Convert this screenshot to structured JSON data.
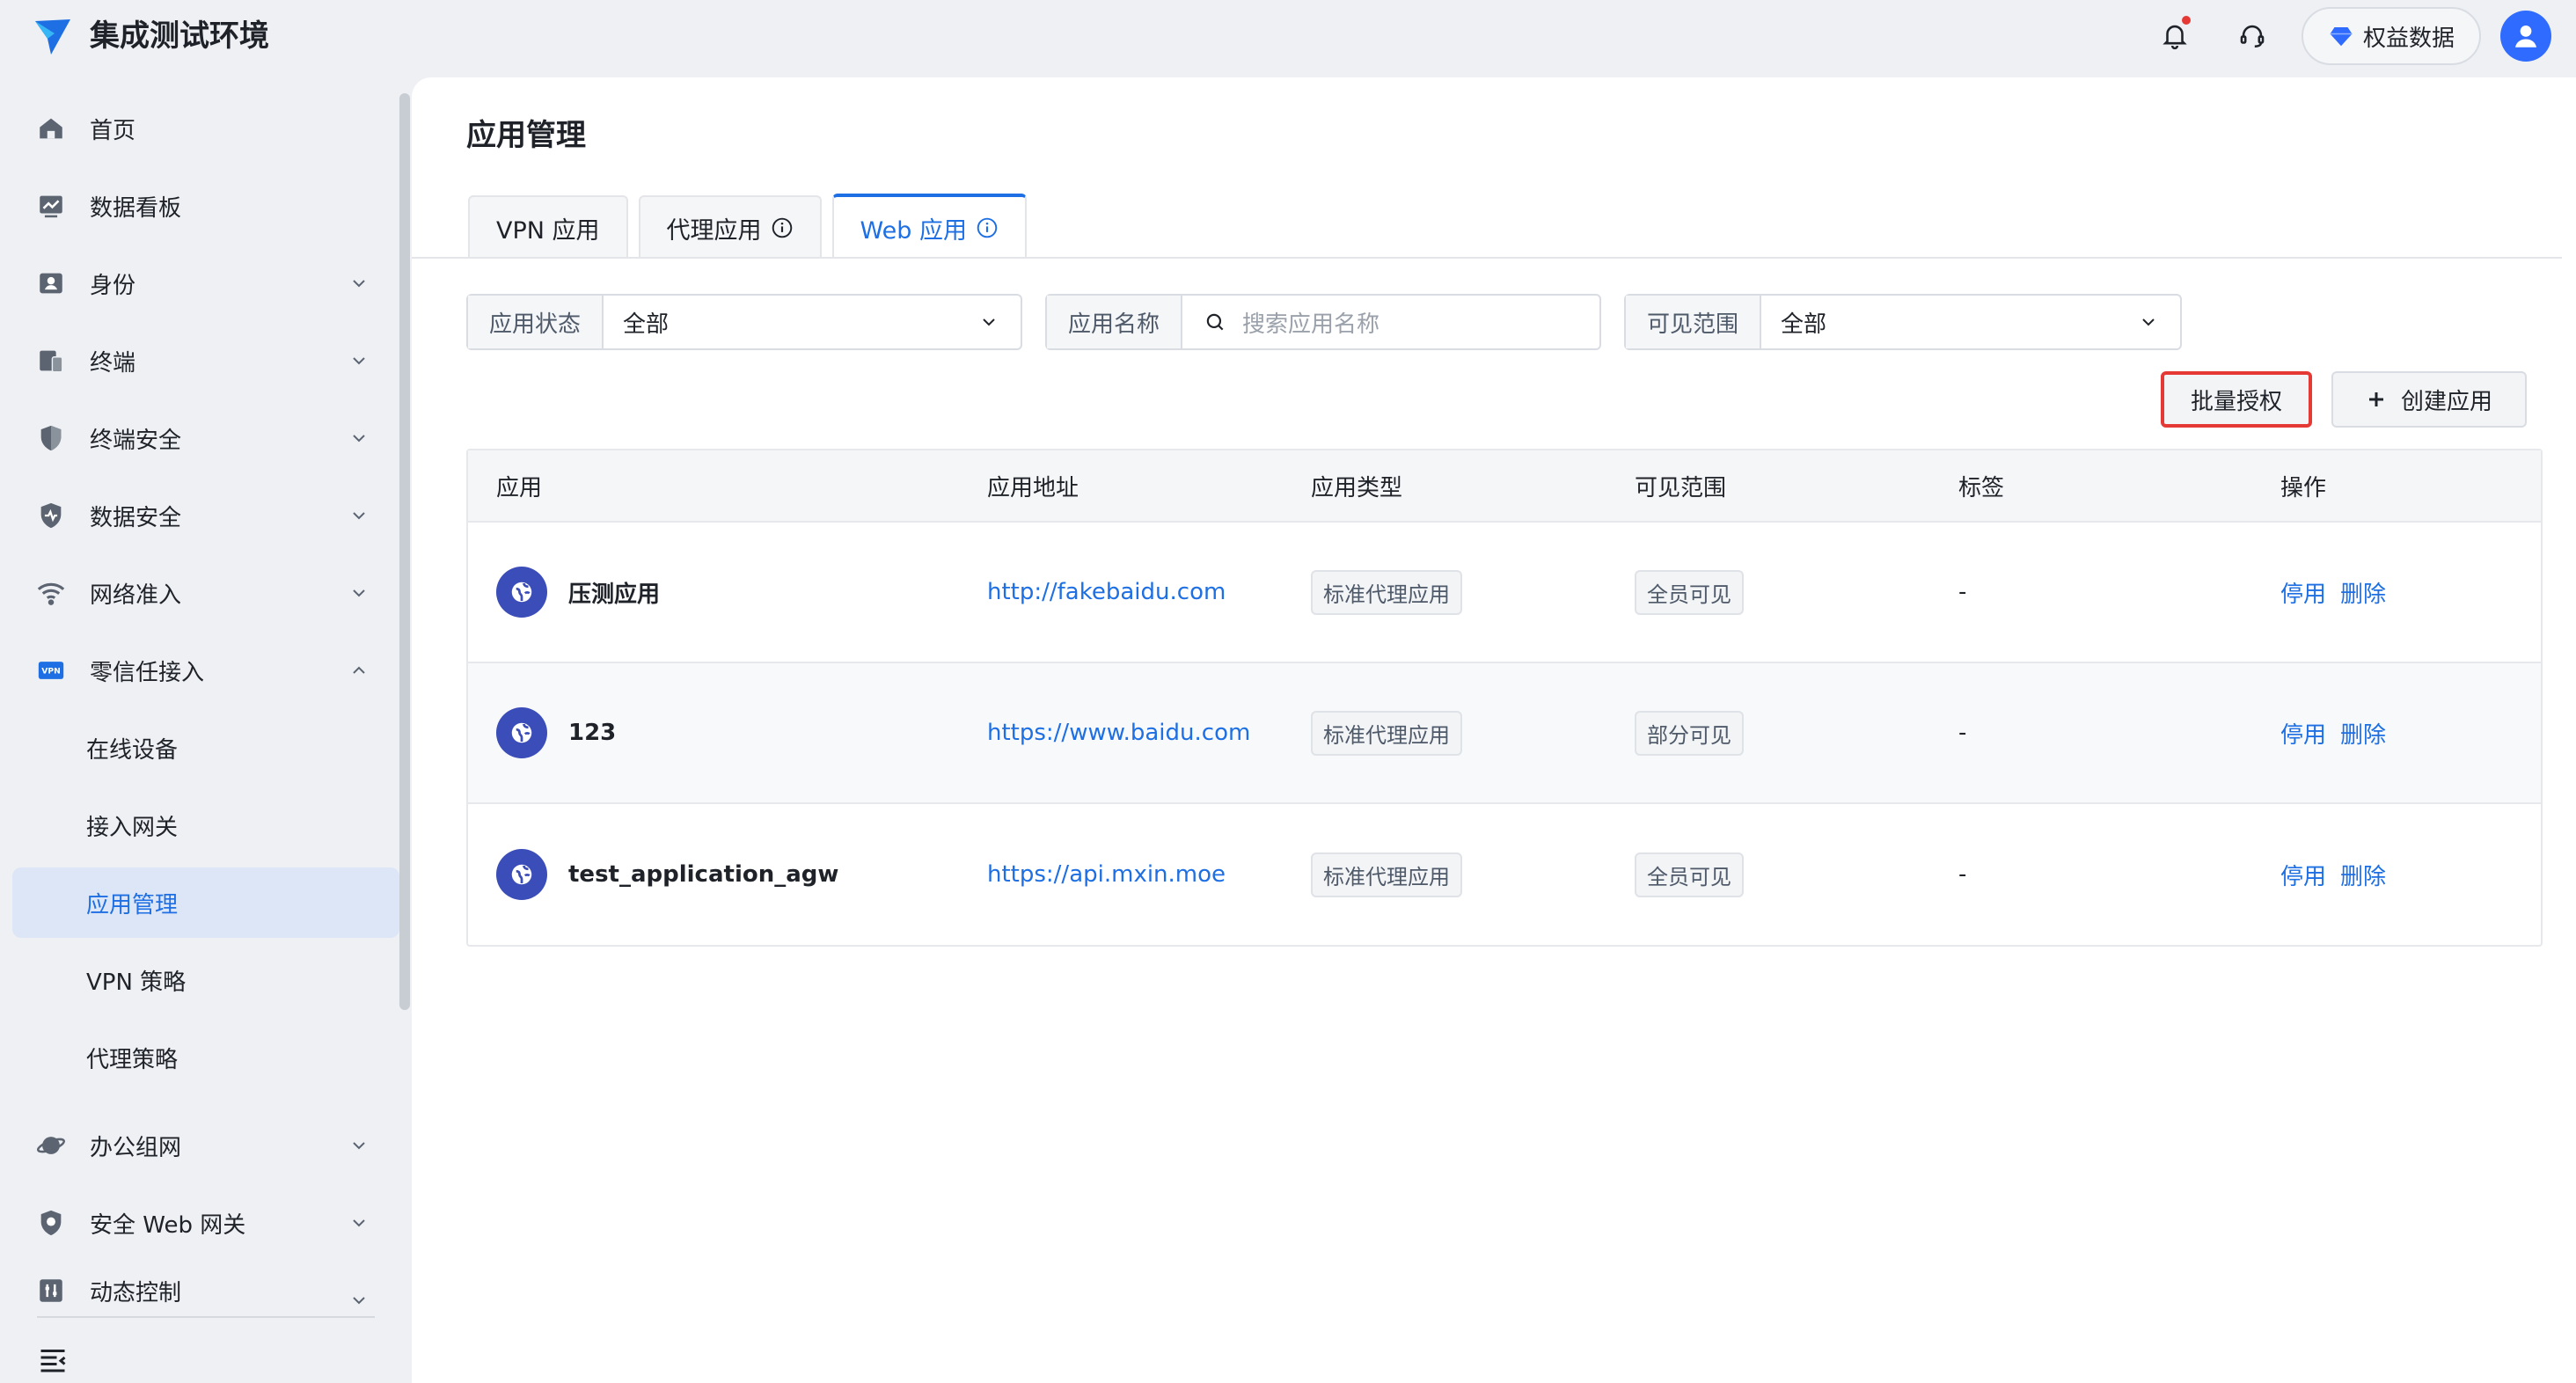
{
  "app": {
    "title": "集成测试环境"
  },
  "header": {
    "equity_label": "权益数据"
  },
  "sidebar": {
    "items": [
      {
        "label": "首页",
        "icon": "home-icon"
      },
      {
        "label": "数据看板",
        "icon": "dashboard-icon"
      },
      {
        "label": "身份",
        "icon": "identity-icon"
      },
      {
        "label": "终端",
        "icon": "devices-icon"
      },
      {
        "label": "终端安全",
        "icon": "shield-icon"
      },
      {
        "label": "数据安全",
        "icon": "data-shield-icon"
      },
      {
        "label": "网络准入",
        "icon": "wifi-icon"
      },
      {
        "label": "零信任接入",
        "icon": "vpn-icon"
      },
      {
        "label": "办公组网",
        "icon": "planet-icon"
      },
      {
        "label": "安全 Web 网关",
        "icon": "gateway-shield-icon"
      },
      {
        "label": "动态控制",
        "icon": "control-icon"
      }
    ],
    "sub_items": [
      "在线设备",
      "接入网关",
      "应用管理",
      "VPN 策略",
      "代理策略"
    ]
  },
  "main": {
    "title": "应用管理",
    "tabs": [
      "VPN 应用",
      "代理应用",
      "Web 应用"
    ],
    "filters": {
      "status_label": "应用状态",
      "status_value": "全部",
      "name_label": "应用名称",
      "name_placeholder": "搜索应用名称",
      "scope_label": "可见范围",
      "scope_value": "全部"
    },
    "buttons": {
      "batch": "批量授权",
      "create": "创建应用"
    },
    "table": {
      "headers": [
        "应用",
        "应用地址",
        "应用类型",
        "可见范围",
        "标签",
        "操作"
      ],
      "rows": [
        {
          "name": "压测应用",
          "url": "http://fakebaidu.com",
          "type": "标准代理应用",
          "scope": "全员可见",
          "tag": "-",
          "op1": "停用",
          "op2": "删除"
        },
        {
          "name": "123",
          "url": "https://www.baidu.com",
          "type": "标准代理应用",
          "scope": "部分可见",
          "tag": "-",
          "op1": "停用",
          "op2": "删除"
        },
        {
          "name": "test_application_agw",
          "url": "https://api.mxin.moe",
          "type": "标准代理应用",
          "scope": "全员可见",
          "tag": "-",
          "op1": "停用",
          "op2": "删除"
        }
      ]
    }
  },
  "colors": {
    "accent": "#1d6fe3",
    "highlight": "#e53935",
    "app_icon": "#3a4db8"
  }
}
